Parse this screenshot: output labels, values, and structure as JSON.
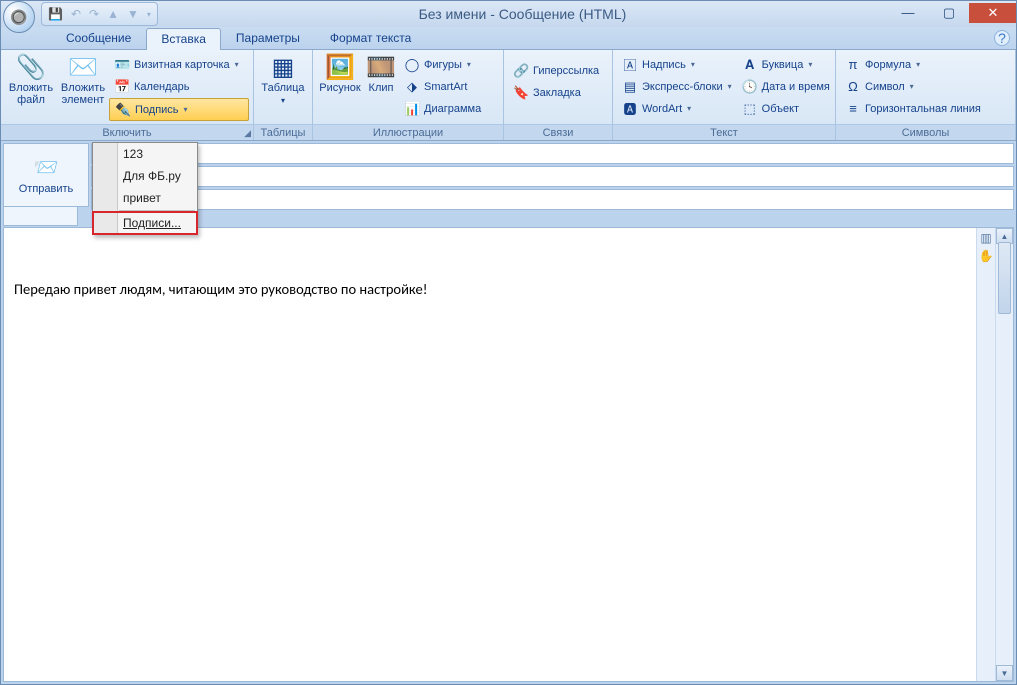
{
  "title": "Без имени - Сообщение (HTML)",
  "tabs": {
    "t0": "Сообщение",
    "t1": "Вставка",
    "t2": "Параметры",
    "t3": "Формат текста"
  },
  "ribbon": {
    "include": {
      "label": "Включить",
      "attach_file": "Вложить\nфайл",
      "attach_item": "Вложить\nэлемент",
      "bizcard": "Визитная карточка",
      "calendar": "Календарь",
      "signature": "Подпись"
    },
    "tables": {
      "label": "Таблицы",
      "table": "Таблица"
    },
    "illus": {
      "label": "Иллюстрации",
      "picture": "Рисунок",
      "clip": "Клип",
      "shapes": "Фигуры",
      "smartart": "SmartArt",
      "chart": "Диаграмма"
    },
    "links": {
      "label": "Связи",
      "hyperlink": "Гиперссылка",
      "bookmark": "Закладка"
    },
    "text": {
      "label": "Текст",
      "textbox": "Надпись",
      "quick": "Экспресс-блоки",
      "wordart": "WordArt",
      "dropcap": "Буквица",
      "datetime": "Дата и время",
      "object": "Объект"
    },
    "symbols": {
      "label": "Символы",
      "formula": "Формула",
      "symbol": "Символ",
      "hr": "Горизонтальная линия"
    }
  },
  "sig_menu": {
    "i0": "123",
    "i1": "Для ФБ.ру",
    "i2": "привет",
    "i3": "Подписи..."
  },
  "send": "Отправить",
  "body_text": "Передаю привет людям, читающим это руководство по настройке!"
}
